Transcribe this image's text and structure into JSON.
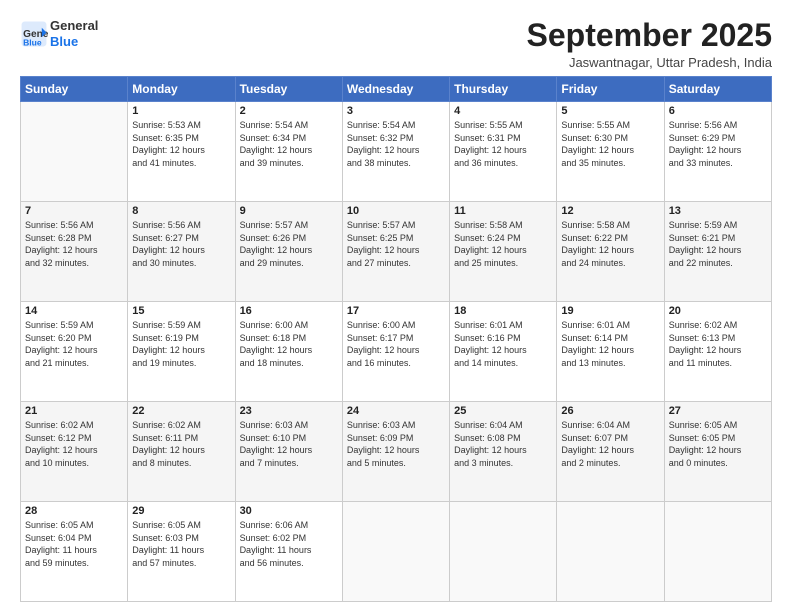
{
  "logo": {
    "line1": "General",
    "line2": "Blue"
  },
  "title": "September 2025",
  "subtitle": "Jaswantnagar, Uttar Pradesh, India",
  "days_header": [
    "Sunday",
    "Monday",
    "Tuesday",
    "Wednesday",
    "Thursday",
    "Friday",
    "Saturday"
  ],
  "weeks": [
    [
      {
        "day": "",
        "info": ""
      },
      {
        "day": "1",
        "info": "Sunrise: 5:53 AM\nSunset: 6:35 PM\nDaylight: 12 hours\nand 41 minutes."
      },
      {
        "day": "2",
        "info": "Sunrise: 5:54 AM\nSunset: 6:34 PM\nDaylight: 12 hours\nand 39 minutes."
      },
      {
        "day": "3",
        "info": "Sunrise: 5:54 AM\nSunset: 6:32 PM\nDaylight: 12 hours\nand 38 minutes."
      },
      {
        "day": "4",
        "info": "Sunrise: 5:55 AM\nSunset: 6:31 PM\nDaylight: 12 hours\nand 36 minutes."
      },
      {
        "day": "5",
        "info": "Sunrise: 5:55 AM\nSunset: 6:30 PM\nDaylight: 12 hours\nand 35 minutes."
      },
      {
        "day": "6",
        "info": "Sunrise: 5:56 AM\nSunset: 6:29 PM\nDaylight: 12 hours\nand 33 minutes."
      }
    ],
    [
      {
        "day": "7",
        "info": "Sunrise: 5:56 AM\nSunset: 6:28 PM\nDaylight: 12 hours\nand 32 minutes."
      },
      {
        "day": "8",
        "info": "Sunrise: 5:56 AM\nSunset: 6:27 PM\nDaylight: 12 hours\nand 30 minutes."
      },
      {
        "day": "9",
        "info": "Sunrise: 5:57 AM\nSunset: 6:26 PM\nDaylight: 12 hours\nand 29 minutes."
      },
      {
        "day": "10",
        "info": "Sunrise: 5:57 AM\nSunset: 6:25 PM\nDaylight: 12 hours\nand 27 minutes."
      },
      {
        "day": "11",
        "info": "Sunrise: 5:58 AM\nSunset: 6:24 PM\nDaylight: 12 hours\nand 25 minutes."
      },
      {
        "day": "12",
        "info": "Sunrise: 5:58 AM\nSunset: 6:22 PM\nDaylight: 12 hours\nand 24 minutes."
      },
      {
        "day": "13",
        "info": "Sunrise: 5:59 AM\nSunset: 6:21 PM\nDaylight: 12 hours\nand 22 minutes."
      }
    ],
    [
      {
        "day": "14",
        "info": "Sunrise: 5:59 AM\nSunset: 6:20 PM\nDaylight: 12 hours\nand 21 minutes."
      },
      {
        "day": "15",
        "info": "Sunrise: 5:59 AM\nSunset: 6:19 PM\nDaylight: 12 hours\nand 19 minutes."
      },
      {
        "day": "16",
        "info": "Sunrise: 6:00 AM\nSunset: 6:18 PM\nDaylight: 12 hours\nand 18 minutes."
      },
      {
        "day": "17",
        "info": "Sunrise: 6:00 AM\nSunset: 6:17 PM\nDaylight: 12 hours\nand 16 minutes."
      },
      {
        "day": "18",
        "info": "Sunrise: 6:01 AM\nSunset: 6:16 PM\nDaylight: 12 hours\nand 14 minutes."
      },
      {
        "day": "19",
        "info": "Sunrise: 6:01 AM\nSunset: 6:14 PM\nDaylight: 12 hours\nand 13 minutes."
      },
      {
        "day": "20",
        "info": "Sunrise: 6:02 AM\nSunset: 6:13 PM\nDaylight: 12 hours\nand 11 minutes."
      }
    ],
    [
      {
        "day": "21",
        "info": "Sunrise: 6:02 AM\nSunset: 6:12 PM\nDaylight: 12 hours\nand 10 minutes."
      },
      {
        "day": "22",
        "info": "Sunrise: 6:02 AM\nSunset: 6:11 PM\nDaylight: 12 hours\nand 8 minutes."
      },
      {
        "day": "23",
        "info": "Sunrise: 6:03 AM\nSunset: 6:10 PM\nDaylight: 12 hours\nand 7 minutes."
      },
      {
        "day": "24",
        "info": "Sunrise: 6:03 AM\nSunset: 6:09 PM\nDaylight: 12 hours\nand 5 minutes."
      },
      {
        "day": "25",
        "info": "Sunrise: 6:04 AM\nSunset: 6:08 PM\nDaylight: 12 hours\nand 3 minutes."
      },
      {
        "day": "26",
        "info": "Sunrise: 6:04 AM\nSunset: 6:07 PM\nDaylight: 12 hours\nand 2 minutes."
      },
      {
        "day": "27",
        "info": "Sunrise: 6:05 AM\nSunset: 6:05 PM\nDaylight: 12 hours\nand 0 minutes."
      }
    ],
    [
      {
        "day": "28",
        "info": "Sunrise: 6:05 AM\nSunset: 6:04 PM\nDaylight: 11 hours\nand 59 minutes."
      },
      {
        "day": "29",
        "info": "Sunrise: 6:05 AM\nSunset: 6:03 PM\nDaylight: 11 hours\nand 57 minutes."
      },
      {
        "day": "30",
        "info": "Sunrise: 6:06 AM\nSunset: 6:02 PM\nDaylight: 11 hours\nand 56 minutes."
      },
      {
        "day": "",
        "info": ""
      },
      {
        "day": "",
        "info": ""
      },
      {
        "day": "",
        "info": ""
      },
      {
        "day": "",
        "info": ""
      }
    ]
  ]
}
